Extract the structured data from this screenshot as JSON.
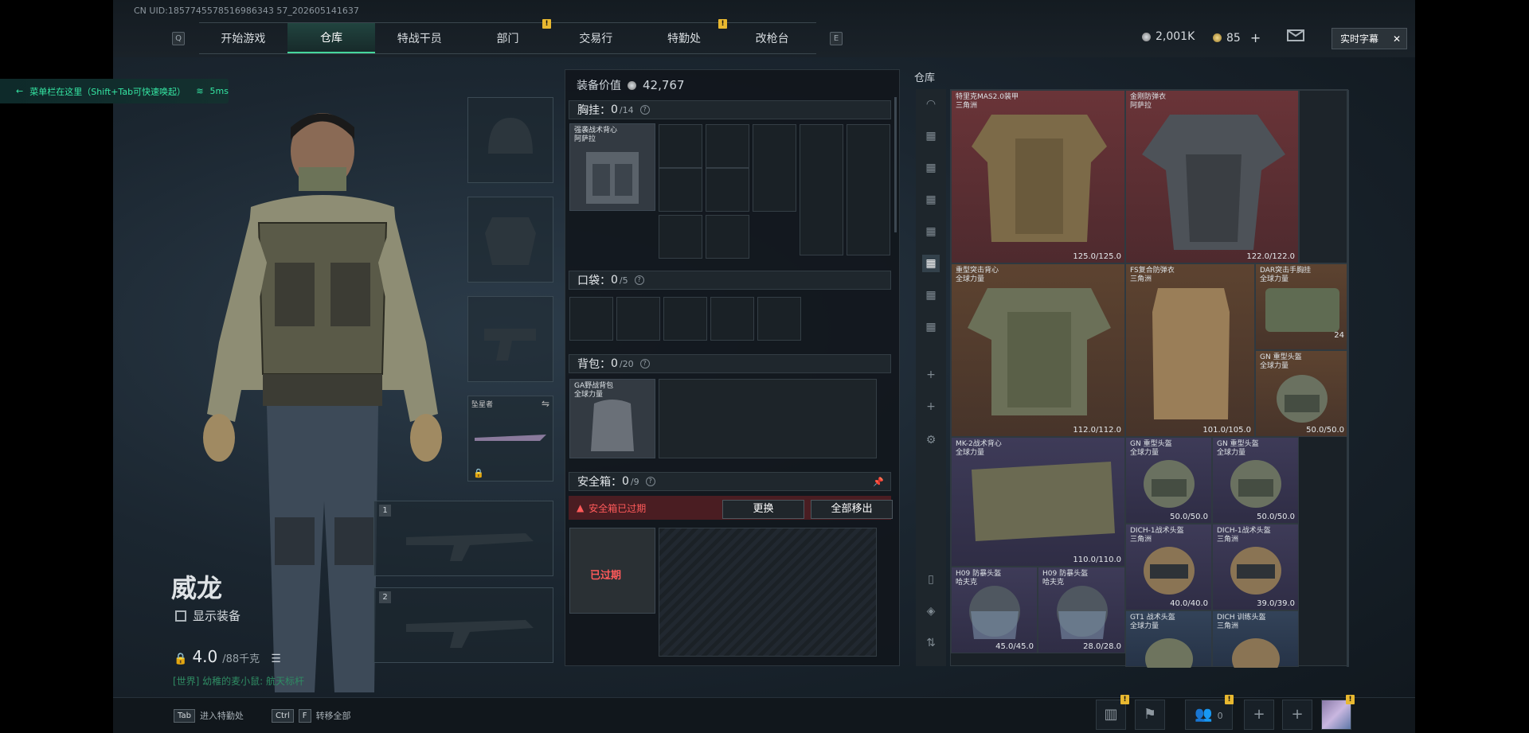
{
  "header": {
    "uid": "CN UID:1857745578516986343 57_202605141637",
    "tabs": [
      "开始游戏",
      "仓库",
      "特战干员",
      "部门",
      "交易行",
      "特勤处",
      "改枪台"
    ],
    "active_tab": 1,
    "key_left": "Q",
    "key_right": "E",
    "silver": "2,001K",
    "gold": "85",
    "plus": "+",
    "live_caption": "实时字幕",
    "close": "✕"
  },
  "status": {
    "hint": "菜单栏在这里（Shift+Tab可快速唤起）",
    "latency": "5ms"
  },
  "character": {
    "name": "威龙",
    "show_gear": "显示装备",
    "weight": "4.0",
    "weight_cap": "/88千克",
    "chat": "[世界] 幼稚的麦小鼠: 航天标杆",
    "melee_name": "坠星者",
    "weapon_slot_1": "1",
    "weapon_slot_2": "2"
  },
  "equipment": {
    "value_label": "装备价值",
    "value": "42,767",
    "chest_label": "胸挂：",
    "chest_count": "0",
    "chest_cap": "/14",
    "chest_item_name": "强袭战术背心",
    "chest_item_sub": "阿萨拉",
    "pocket_label": "口袋：",
    "pocket_count": "0",
    "pocket_cap": "/5",
    "backpack_label": "背包：",
    "backpack_count": "0",
    "backpack_cap": "/20",
    "backpack_item_name": "GA野战背包",
    "backpack_item_sub": "全球力量",
    "safe_label": "安全箱：",
    "safe_count": "0",
    "safe_cap": "/9",
    "safe_warning": "安全箱已过期",
    "replace_button": "更换",
    "move_all_button": "全部移出",
    "expired": "已过期"
  },
  "warehouse": {
    "title": "仓库",
    "items": [
      {
        "name": "特里克MAS2.0装甲",
        "sub": "三角洲",
        "dur": "125.0/125.0",
        "rarity": "red"
      },
      {
        "name": "金刚防弹衣",
        "sub": "阿萨拉",
        "dur": "122.0/122.0",
        "rarity": "red"
      },
      {
        "name": "重型突击背心",
        "sub": "全球力量",
        "dur": "112.0/112.0",
        "rarity": "orange"
      },
      {
        "name": "FS复合防弹衣",
        "sub": "三角洲",
        "dur": "101.0/105.0",
        "rarity": "orange"
      },
      {
        "name": "DAR突击手胸挂",
        "sub": "全球力量",
        "dur": "",
        "rarity": "orange",
        "count": "24"
      },
      {
        "name": "GN 重型头盔",
        "sub": "全球力量",
        "dur": "50.0/50.0",
        "rarity": "orange"
      },
      {
        "name": "MK-2战术背心",
        "sub": "全球力量",
        "dur": "110.0/110.0",
        "rarity": "purple"
      },
      {
        "name": "GN 重型头盔",
        "sub": "全球力量",
        "dur": "50.0/50.0",
        "rarity": "purple"
      },
      {
        "name": "GN 重型头盔",
        "sub": "全球力量",
        "dur": "50.0/50.0",
        "rarity": "purple"
      },
      {
        "name": "DICH-1战术头盔",
        "sub": "三角洲",
        "dur": "40.0/40.0",
        "rarity": "purple"
      },
      {
        "name": "DICH-1战术头盔",
        "sub": "三角洲",
        "dur": "39.0/39.0",
        "rarity": "purple"
      },
      {
        "name": "H09 防暴头盔",
        "sub": "哈夫克",
        "dur": "45.0/45.0",
        "rarity": "purple"
      },
      {
        "name": "H09 防暴头盔",
        "sub": "哈夫克",
        "dur": "28.0/28.0",
        "rarity": "purple"
      },
      {
        "name": "GT1 战术头盔",
        "sub": "全球力量",
        "dur": "",
        "rarity": "blue"
      },
      {
        "name": "DICH 训练头盔",
        "sub": "三角洲",
        "dur": "",
        "rarity": "blue"
      }
    ]
  },
  "bottom": {
    "key1": "Tab",
    "action1": "进入特勤处",
    "key2a": "Ctrl",
    "key2b": "F",
    "action2": "转移全部",
    "friends_count": "0",
    "badge": "!"
  }
}
